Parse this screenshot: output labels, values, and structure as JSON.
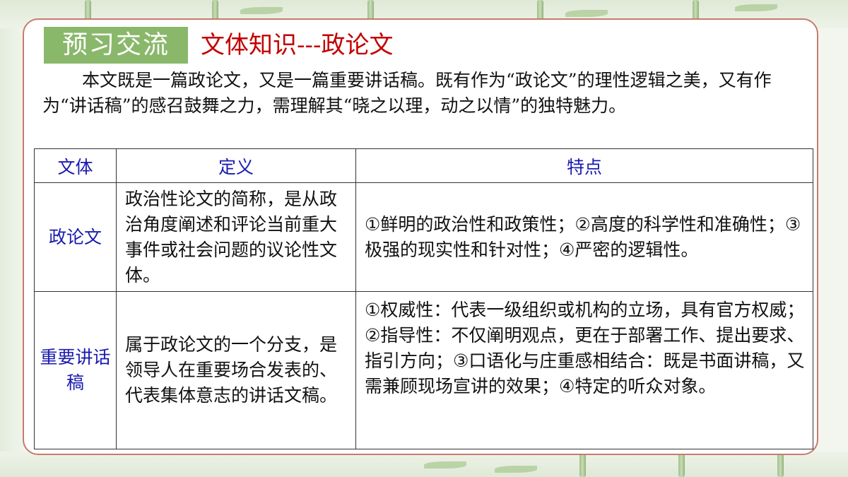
{
  "tag": "预习交流",
  "heading": "文体知识---政论文",
  "intro": "本文既是一篇政论文，又是一篇重要讲话稿。既有作为“政论文”的理性逻辑之美，又有作为“讲话稿”的感召鼓舞之力，需理解其“晓之以理，动之以情”的独特魅力。",
  "table": {
    "headers": [
      "文体",
      "定义",
      "特点"
    ],
    "rows": [
      {
        "type": "政论文",
        "definition": "政治性论文的简称，是从政治角度阐述和评论当前重大事件或社会问题的议论性文体。",
        "features": "①鲜明的政治性和政策性；②高度的科学性和准确性；③极强的现实性和针对性；④严密的逻辑性。"
      },
      {
        "type": "重要讲话稿",
        "definition": "属于政论文的一个分支，是领导人在重要场合发表的、代表集体意志的讲话文稿。",
        "features": "①权威性：代表一级组织或机构的立场，具有官方权威；②指导性：不仅阐明观点，更在于部署工作、提出要求、指引方向；③口语化与庄重感相结合：既是书面讲稿，又需兼顾现场宣讲的效果；④特定的听众对象。"
      }
    ]
  }
}
